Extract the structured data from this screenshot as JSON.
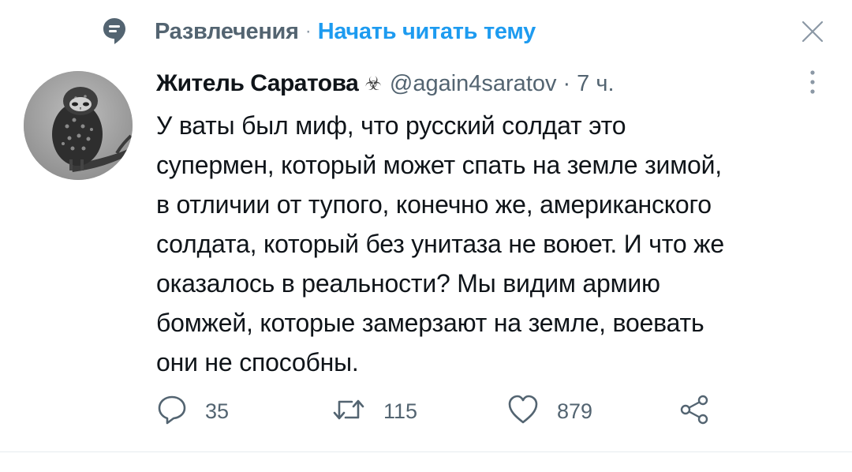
{
  "topic": {
    "name": "Развлечения",
    "separator": "·",
    "follow_label": "Начать читать тему"
  },
  "tweet": {
    "display_name": "Житель Саратова",
    "name_emoji": "☣",
    "handle": "@again4saratov",
    "separator": "·",
    "time": "7 ч.",
    "text": "У ваты был миф, что русский солдат это\nсупермен, который может спать на земле зимой,\nв отличии от тупого, конечно же, американского\nсолдата, который без унитаза не воюет. И что же\nоказалось в реальности? Мы видим армию\nбомжей, которые замерзают на земле, воевать\nони не способны."
  },
  "actions": {
    "reply_count": "35",
    "retweet_count": "115",
    "like_count": "879"
  },
  "icons": {
    "topic": "topic-icon",
    "close": "close-icon",
    "more": "more-vertical-icon",
    "reply": "reply-icon",
    "retweet": "retweet-icon",
    "like": "heart-icon",
    "share": "share-icon"
  },
  "colors": {
    "text": "#0f1419",
    "secondary": "#536471",
    "accent": "#1d9bf0",
    "icon": "#536471"
  }
}
